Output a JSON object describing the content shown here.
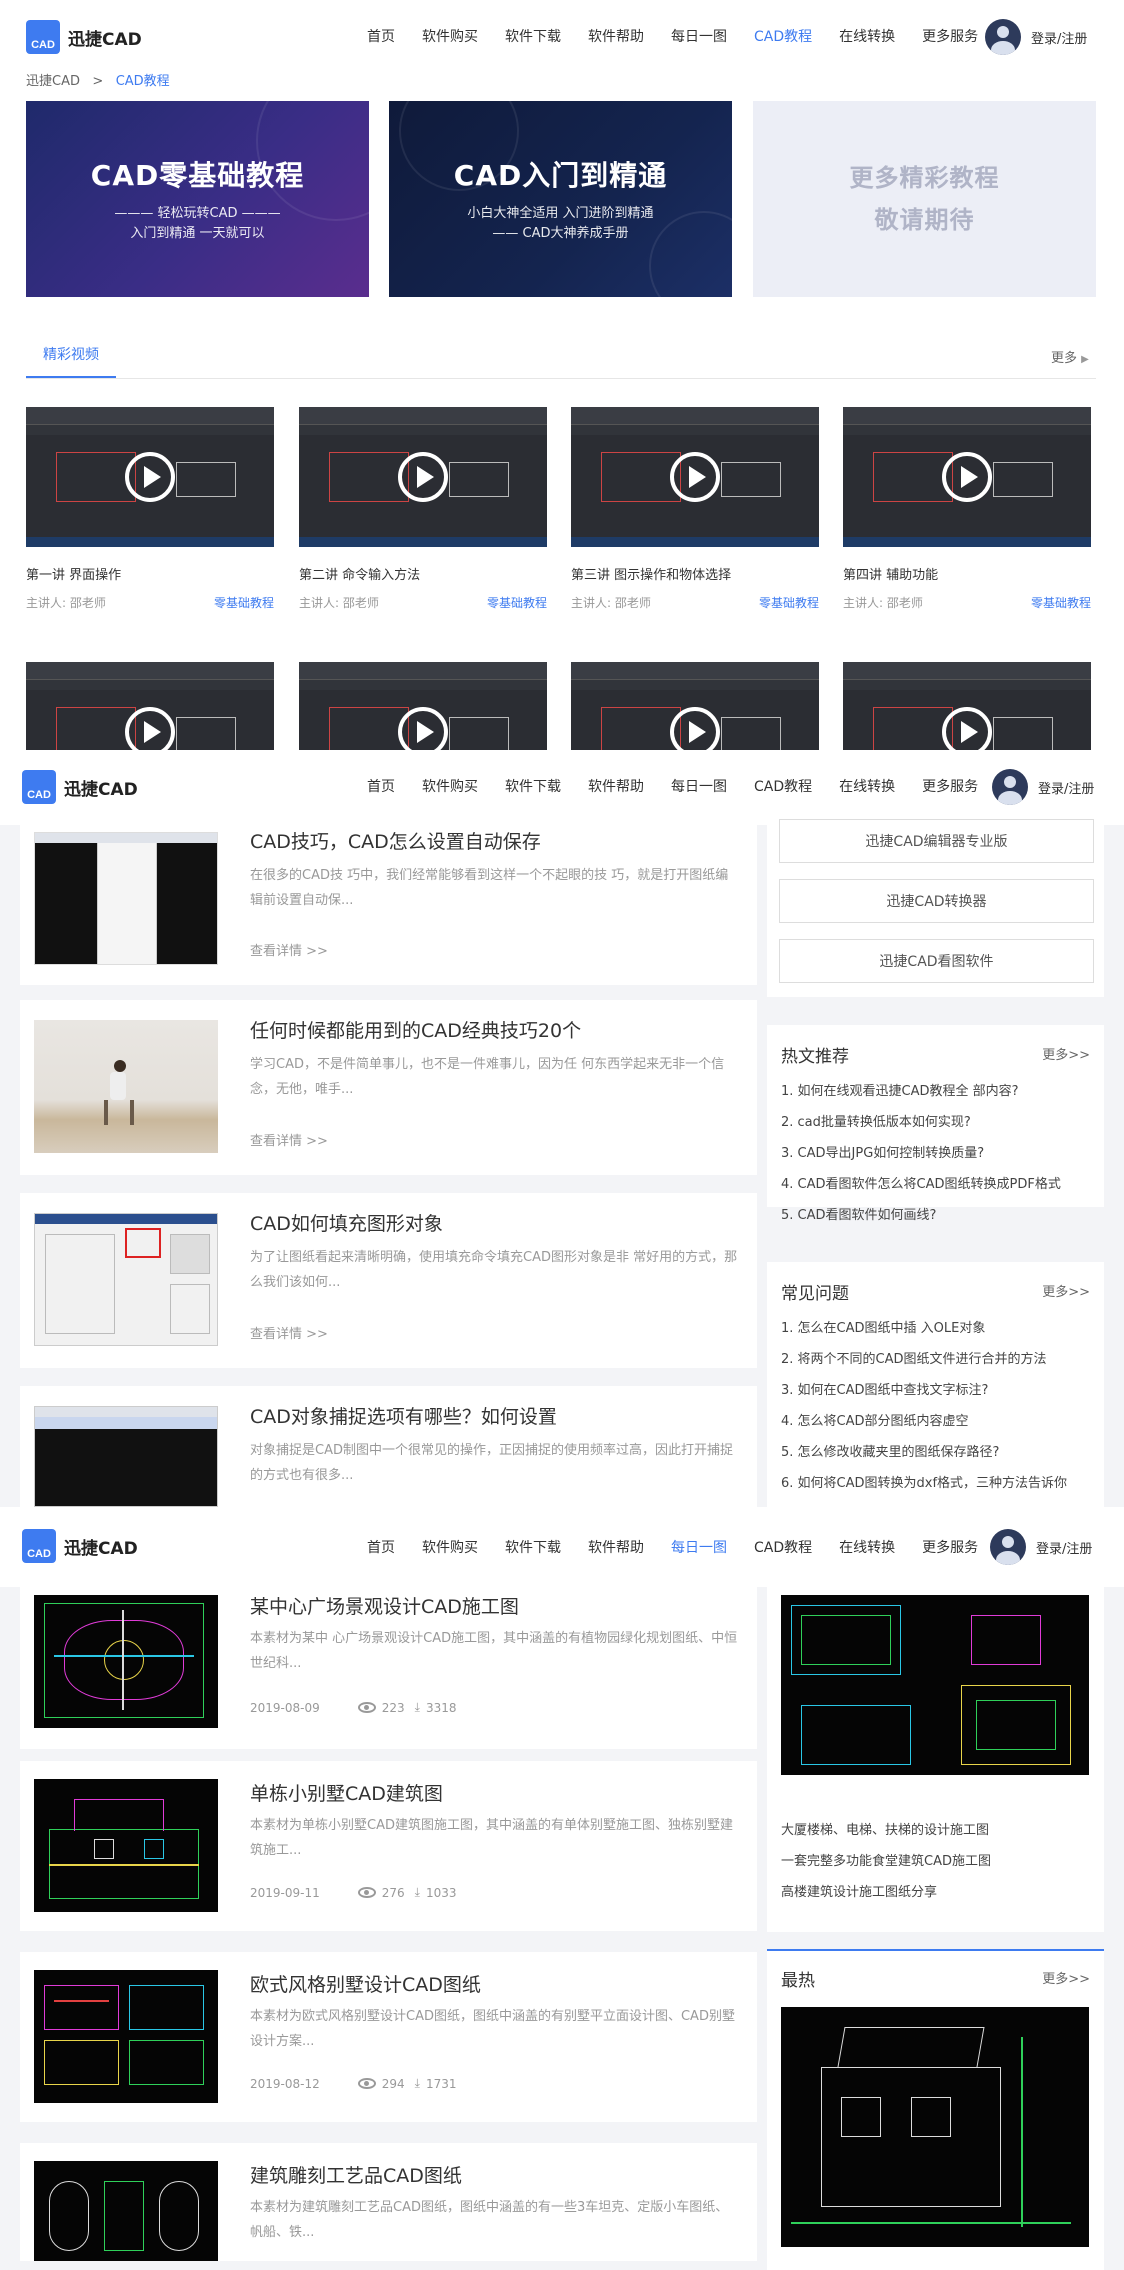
{
  "header": {
    "logo_mark": "CAD",
    "logo_text": "迅捷CAD",
    "nav": [
      "首页",
      "软件购买",
      "软件下载",
      "软件帮助",
      "每日一图",
      "CAD教程",
      "在线转换",
      "更多服务"
    ],
    "login": "登录/注册"
  },
  "s1": {
    "breadcrumb": {
      "root": "迅捷CAD",
      "sep": ">",
      "current": "CAD教程"
    },
    "banners": [
      {
        "title": "CAD零基础教程",
        "sub1": "——— 轻松玩转CAD ———",
        "sub2": "入门到精通 一天就可以"
      },
      {
        "title": "CAD入门到精通",
        "sub1": "小白大神全适用 入门进阶到精通",
        "sub2": "—— CAD大神养成手册"
      },
      {
        "title": "更多精彩教程",
        "sub1": "敬请期待"
      }
    ],
    "section_tab": "精彩视频",
    "more": "更多",
    "videos": [
      {
        "title": "第一讲 界面操作",
        "lecturer": "主讲人: 邵老师",
        "tag": "零基础教程"
      },
      {
        "title": "第二讲 命令输入方法",
        "lecturer": "主讲人: 邵老师",
        "tag": "零基础教程"
      },
      {
        "title": "第三讲 图示操作和物体选择",
        "lecturer": "主讲人: 邵老师",
        "tag": "零基础教程"
      },
      {
        "title": "第四讲 辅助功能",
        "lecturer": "主讲人: 邵老师",
        "tag": "零基础教程"
      }
    ]
  },
  "s2": {
    "articles": [
      {
        "title": "CAD技巧，CAD怎么设置自动保存",
        "desc": "在很多的CAD技 巧中，我们经常能够看到这样一个不起眼的技 巧，就是打开图纸编辑前设置自动保...",
        "more": "查看详情 >>"
      },
      {
        "title": "任何时候都能用到的CAD经典技巧20个",
        "desc": "学习CAD，不是件简单事儿，也不是一件难事儿，因为任 何东西学起来无非一个信念，无他，唯手...",
        "more": "查看详情 >>"
      },
      {
        "title": "CAD如何填充图形对象",
        "desc": "为了让图纸看起来清晰明确，使用填充命令填充CAD图形对象是非 常好用的方式，那么我们该如何...",
        "more": "查看详情 >>"
      },
      {
        "title": "CAD对象捕捉选项有哪些？如何设置",
        "desc": "对象捕捉是CAD制图中一个很常见的操作，正因捕捉的使用频率过高，因此打开捕捉的方式也有很多...",
        "more": ""
      }
    ],
    "software": [
      "迅捷CAD编辑器专业版",
      "迅捷CAD转换器",
      "迅捷CAD看图软件"
    ],
    "hot": {
      "title": "热文推荐",
      "more": "更多>>",
      "items": [
        "1. 如何在线观看迅捷CAD教程全 部内容?",
        "2. cad批量转换低版本如何实现?",
        "3. CAD导出JPG如何控制转换质量?",
        "4. CAD看图软件怎么将CAD图纸转换成PDF格式",
        "5. CAD看图软件如何画线?"
      ]
    },
    "faq": {
      "title": "常见问题",
      "more": "更多>>",
      "items": [
        "1. 怎么在CAD图纸中插 入OLE对象",
        "2. 将两个不同的CAD图纸文件进行合并的方法",
        "3. 如何在CAD图纸中查找文字标注?",
        "4. 怎么将CAD部分图纸内容虚空",
        "5. 怎么修改收藏夹里的图纸保存路径?",
        "6. 如何将CAD图转换为dxf格式，三种方法告诉你"
      ]
    }
  },
  "s3": {
    "drawings": [
      {
        "title": "某中心广场景观设计CAD施工图",
        "desc": "本素材为某中 心广场景观设计CAD施工图，其中涵盖的有植物园绿化规划图纸、中恒世纪科...",
        "date": "2019-08-09",
        "views": "223",
        "downloads": "3318"
      },
      {
        "title": "单栋小别墅CAD建筑图",
        "desc": "本素材为单栋小别墅CAD建筑图施工图，其中涵盖的有单体别墅施工图、独栋别墅建筑施工...",
        "date": "2019-09-11",
        "views": "276",
        "downloads": "1033"
      },
      {
        "title": "欧式风格别墅设计CAD图纸",
        "desc": "本素材为欧式风格别墅设计CAD图纸，图纸中涵盖的有别墅平立面设计图、CAD别墅设计方案...",
        "date": "2019-08-12",
        "views": "294",
        "downloads": "1731"
      },
      {
        "title": "建筑雕刻工艺品CAD图纸",
        "desc": "本素材为建筑雕刻工艺品CAD图纸，图纸中涵盖的有一些3车坦克、定版小车图纸、帆船、铁...",
        "date": "",
        "views": "",
        "downloads": ""
      }
    ],
    "side_links": [
      "大厦楼梯、电梯、扶梯的设计施工图",
      "一套完整多功能食堂建筑CAD施工图",
      "高楼建筑设计施工图纸分享"
    ],
    "hot": {
      "title": "最热",
      "more": "更多>>"
    }
  }
}
